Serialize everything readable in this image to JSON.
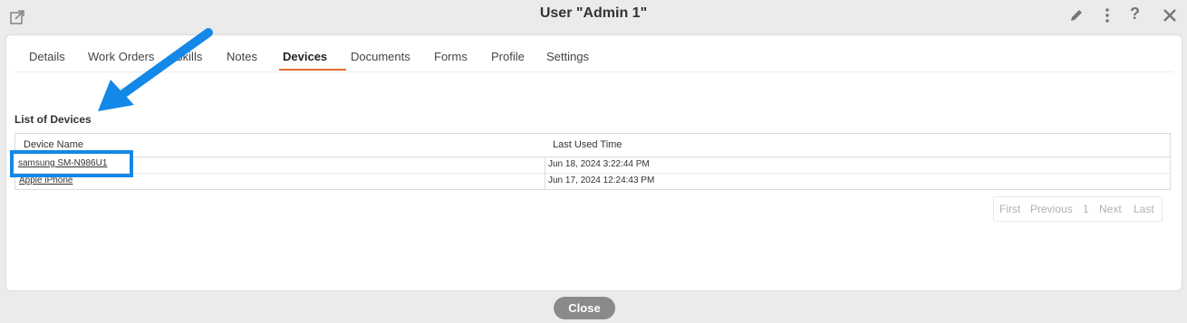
{
  "window": {
    "title": "User \"Admin 1\""
  },
  "tabs": [
    {
      "label": "Details"
    },
    {
      "label": "Work Orders"
    },
    {
      "label": "Skills"
    },
    {
      "label": "Notes"
    },
    {
      "label": "Devices"
    },
    {
      "label": "Documents"
    },
    {
      "label": "Forms"
    },
    {
      "label": "Profile"
    },
    {
      "label": "Settings"
    }
  ],
  "active_tab": "Devices",
  "section_title": "List of Devices",
  "table": {
    "headers": [
      "Device Name",
      "Last Used Time"
    ],
    "rows": [
      {
        "device": "samsung SM-N986U1",
        "last_used": "Jun 18, 2024 3:22:44 PM"
      },
      {
        "device": "Apple iPhone",
        "last_used": "Jun 17, 2024 12:24:43 PM"
      }
    ]
  },
  "pager": {
    "first": "First",
    "previous": "Previous",
    "page": "1",
    "next": "Next",
    "last": "Last"
  },
  "footer": {
    "close_label": "Close"
  },
  "colors": {
    "accent": "#e36b2c",
    "annotation": "#1388e8"
  },
  "icons": [
    "popout-icon",
    "edit-icon",
    "more-icon",
    "help-icon",
    "close-icon"
  ]
}
